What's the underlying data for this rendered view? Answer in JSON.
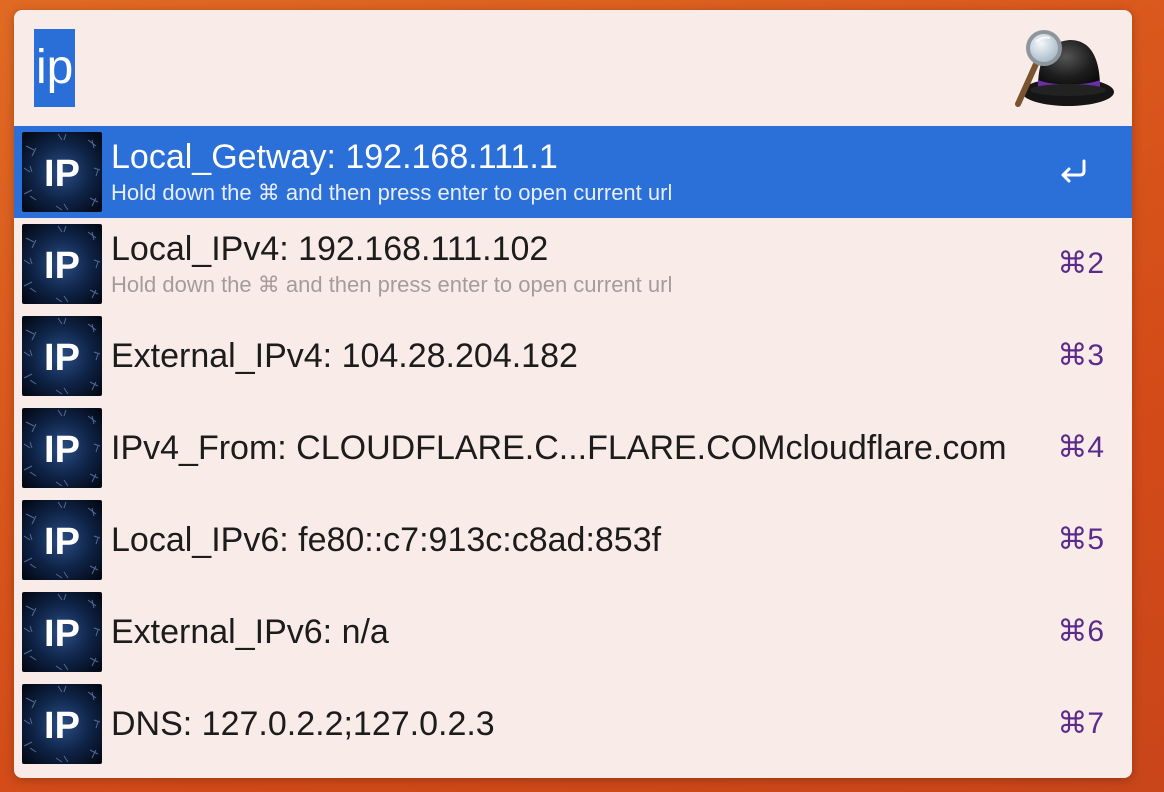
{
  "search": {
    "query": "ip"
  },
  "colors": {
    "selection": "#2b6fd9",
    "shortcut": "#5b2a8a",
    "panel": "#f9ece8"
  },
  "icons": {
    "app_logo": "alfred-hat-icon",
    "result_icon": "ip-icon",
    "enter": "return-key-icon"
  },
  "results": [
    {
      "title": "Local_Getway: 192.168.111.1",
      "subtitle": "Hold down the ⌘ and then press enter to open current url",
      "shortcut": "",
      "selected": true,
      "icon_label": "IP"
    },
    {
      "title": "Local_IPv4: 192.168.111.102",
      "subtitle": "Hold down the ⌘ and then press enter to open current url",
      "shortcut": "⌘2",
      "selected": false,
      "icon_label": "IP"
    },
    {
      "title": "External_IPv4: 104.28.204.182",
      "subtitle": "",
      "shortcut": "⌘3",
      "selected": false,
      "icon_label": "IP"
    },
    {
      "title": "IPv4_From: CLOUDFLARE.C...FLARE.COMcloudflare.com",
      "subtitle": "",
      "shortcut": "⌘4",
      "selected": false,
      "icon_label": "IP"
    },
    {
      "title": "Local_IPv6: fe80::c7:913c:c8ad:853f",
      "subtitle": "",
      "shortcut": "⌘5",
      "selected": false,
      "icon_label": "IP"
    },
    {
      "title": "External_IPv6: n/a",
      "subtitle": "",
      "shortcut": "⌘6",
      "selected": false,
      "icon_label": "IP"
    },
    {
      "title": "DNS: 127.0.2.2;127.0.2.3",
      "subtitle": "",
      "shortcut": "⌘7",
      "selected": false,
      "icon_label": "IP"
    }
  ]
}
